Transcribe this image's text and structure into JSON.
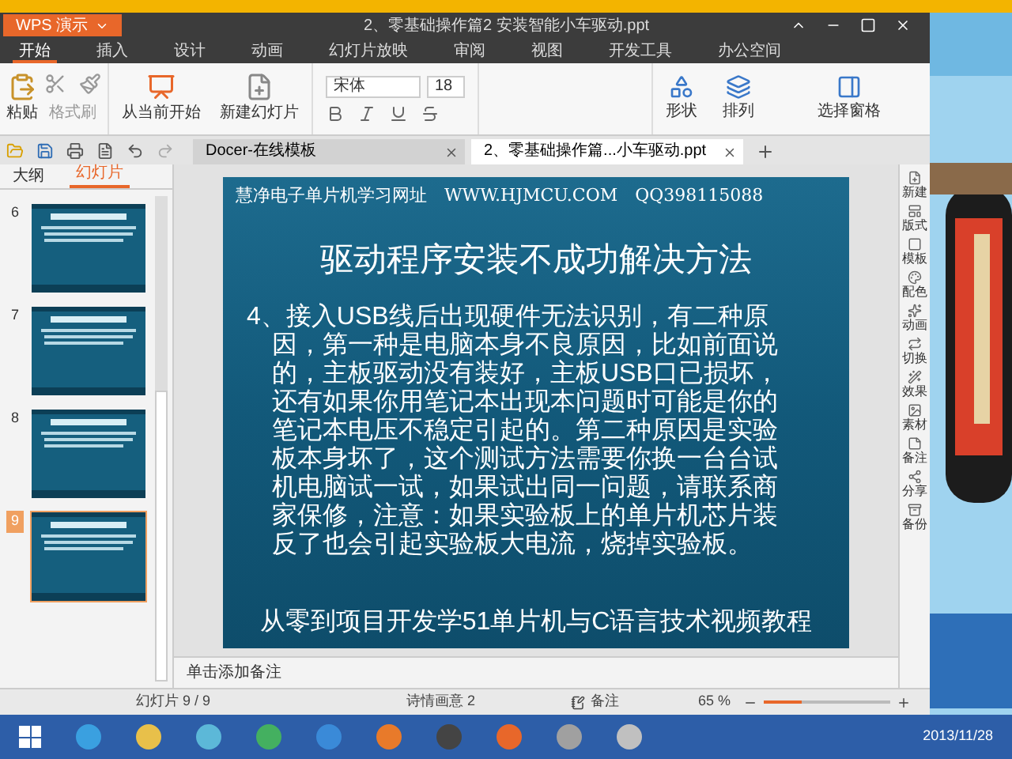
{
  "app_button": "WPS 演示",
  "window": {
    "title": "2、零基础操作篇2 安装智能小车驱动.ppt"
  },
  "menu": [
    {
      "label": "开始",
      "selected": true
    },
    {
      "label": "插入",
      "selected": false
    },
    {
      "label": "设计",
      "selected": false
    },
    {
      "label": "动画",
      "selected": false
    },
    {
      "label": "幻灯片放映",
      "selected": false
    },
    {
      "label": "审阅",
      "selected": false
    },
    {
      "label": "视图",
      "selected": false
    },
    {
      "label": "开发工具",
      "selected": false
    },
    {
      "label": "办公空间",
      "selected": false
    }
  ],
  "ribbon": {
    "paste": "粘贴",
    "format_painter": "格式刷",
    "from_current": "从当前开始",
    "new_slide": "新建幻灯片",
    "font": "宋体",
    "size": "18",
    "shape": "形状",
    "arrange": "排列",
    "selection_pane": "选择窗格"
  },
  "doc_tabs": [
    {
      "label": "Docer-在线模板",
      "selected": false
    },
    {
      "label": "2、零基础操作篇...小车驱动.ppt",
      "selected": true
    }
  ],
  "panel_tabs": [
    {
      "label": "大纲",
      "selected": false
    },
    {
      "label": "幻灯片",
      "selected": true
    }
  ],
  "thumbnails": [
    {
      "number": "6",
      "selected": false
    },
    {
      "number": "7",
      "selected": false
    },
    {
      "number": "8",
      "selected": false
    },
    {
      "number": "9",
      "selected": true
    }
  ],
  "slide": {
    "header": "慧净电子单片机学习网址　WWW.HJMCU.COM　QQ398115088",
    "title": "驱动程序安装不成功解决方法",
    "body": "4、接入USB线后出现硬件无法识别，有二种原因，第一种是电脑本身不良原因，比如前面说的，主板驱动没有装好，主板USB口已损坏，还有如果你用笔记本出现本问题时可能是你的笔记本电压不稳定引起的。第二种原因是实验板本身坏了，这个测试方法需要你换一台台试机电脑试一试，如果试出同一问题，请联系商家保修，注意：如果实验板上的单片机芯片装反了也会引起实验板大电流，烧掉实验板。",
    "footer": "从零到项目开发学51单片机与C语言技术视频教程"
  },
  "notes_placeholder": "单击添加备注",
  "side_tools": [
    "新建",
    "版式",
    "模板",
    "配色",
    "动画",
    "切换",
    "效果",
    "素材",
    "备注",
    "分享",
    "备份"
  ],
  "status_bar": {
    "slide_count": "幻灯片 9 / 9",
    "theme": "诗情画意 2",
    "notes": "备注",
    "zoom": "65 %",
    "zoom_slider": {
      "level": 0.3
    }
  },
  "taskbar": {
    "date": "2013/11/28"
  }
}
